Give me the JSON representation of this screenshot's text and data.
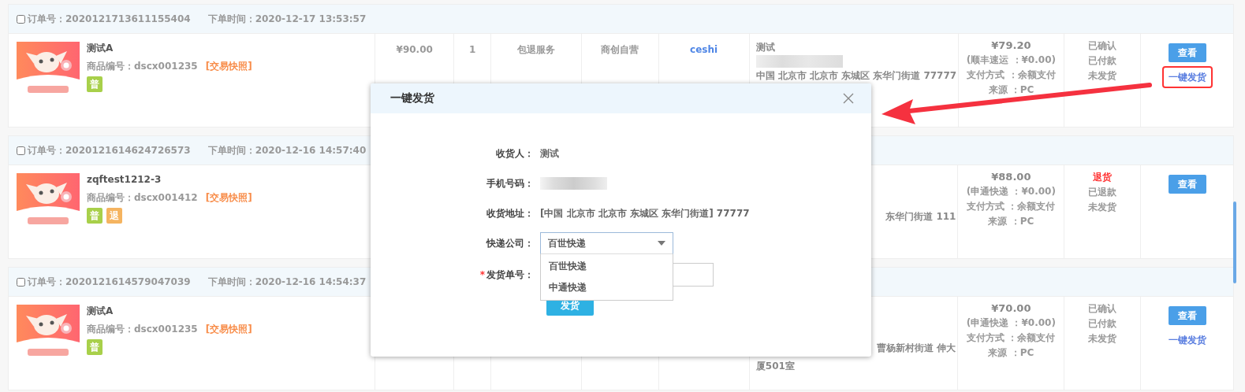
{
  "orders": [
    {
      "checked": false,
      "order_no": "订单号：2020121713611155404",
      "order_time": "下单时间：2020-12-17 13:53:57",
      "product": {
        "name": "测试A",
        "code": "商品编号：dscx001235",
        "snapshot": "[交易快照]",
        "tags": [
          {
            "label": "普",
            "color": "#a8d04a"
          }
        ]
      },
      "price": "¥90.00",
      "qty": "1",
      "service": "包退服务",
      "shop": "商创自营",
      "buyer": "ceshi",
      "address": [
        {
          "kind": "text",
          "text": "测试"
        },
        {
          "kind": "redacted"
        },
        {
          "kind": "text",
          "text": "中国 北京市 北京市 东城区 东华门街道 77777"
        }
      ],
      "amount": [
        "¥79.20",
        "(顺丰速运 ：¥0.00)",
        "支付方式 ：余额支付",
        "来源 ：PC"
      ],
      "status": [
        {
          "text": "已确认",
          "alert": false
        },
        {
          "text": "已付款",
          "alert": false
        },
        {
          "text": "未发货",
          "alert": false
        }
      ],
      "view": "查看",
      "ship": {
        "text": "一键发货",
        "highlighted": true
      }
    },
    {
      "checked": false,
      "order_no": "订单号：2020121614624726573",
      "order_time": "下单时间：2020-12-16 14:57:40",
      "product": {
        "name": "zqftest1212-3",
        "code": "商品编号：dscx001412",
        "snapshot": "[交易快照]",
        "tags": [
          {
            "label": "普",
            "color": "#a8d04a"
          },
          {
            "label": "退",
            "color": "#f5b460"
          }
        ]
      },
      "address": [
        {
          "kind": "fragment",
          "text": "东华门街道 111"
        }
      ],
      "amount": [
        "¥88.00",
        "(申通快递 ：¥0.00)",
        "支付方式 ：余额支付",
        "来源 ：PC"
      ],
      "status": [
        {
          "text": "退货",
          "alert": true
        },
        {
          "text": "已退款",
          "alert": false
        },
        {
          "text": "未发货",
          "alert": false
        }
      ],
      "view": "查看"
    },
    {
      "checked": false,
      "order_no": "订单号：2020121614579047039",
      "order_time": "下单时间：2020-12-16 14:54:37",
      "product": {
        "name": "测试A",
        "code": "商品编号：dscx001235",
        "snapshot": "[交易快照]",
        "tags": [
          {
            "label": "普",
            "color": "#a8d04a"
          }
        ]
      },
      "address": [
        {
          "kind": "fragment",
          "text": "曹杨新村街道 伸大"
        },
        {
          "kind": "text",
          "text": "厦501室"
        }
      ],
      "amount": [
        "¥70.00",
        "(申通快递 ：¥0.00)",
        "支付方式 ：余额支付",
        "来源 ：PC"
      ],
      "status": [
        {
          "text": "已确认",
          "alert": false
        },
        {
          "text": "已付款",
          "alert": false
        },
        {
          "text": "未发货",
          "alert": false
        }
      ],
      "view": "查看",
      "ship": {
        "text": "一键发货",
        "highlighted": false
      }
    }
  ],
  "dialog": {
    "title": "一键发货",
    "fields": [
      {
        "kind": "text",
        "label": "收货人：",
        "value": "测试"
      },
      {
        "kind": "redacted",
        "label": "手机号码："
      },
      {
        "kind": "text",
        "label": "收货地址：",
        "value": "[中国 北京市 北京市 东城区 东华门街道] 77777"
      },
      {
        "kind": "select",
        "label": "快递公司：",
        "value": "百世快递",
        "expanded": true,
        "options": [
          "百世快递",
          "中通快递"
        ]
      },
      {
        "kind": "input",
        "label": "发货单号：",
        "required_mark": "*"
      }
    ],
    "submit": "发货"
  }
}
